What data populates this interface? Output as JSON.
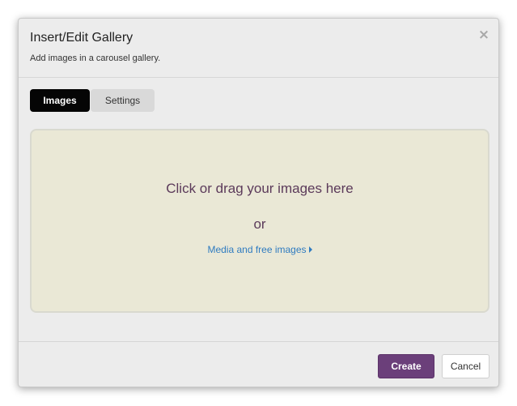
{
  "dialog": {
    "title": "Insert/Edit Gallery",
    "subtitle": "Add images in a carousel gallery.",
    "close_icon": "close-icon"
  },
  "tabs": [
    {
      "label": "Images",
      "active": true
    },
    {
      "label": "Settings",
      "active": false
    }
  ],
  "dropzone": {
    "main_text": "Click or drag your images here",
    "or_text": "or",
    "link_text": "Media and free images",
    "link_icon": "caret-right-icon"
  },
  "buttons": {
    "create_label": "Create",
    "cancel_label": "Cancel"
  },
  "colors": {
    "primary_button": "#6b3f7a",
    "dropzone_bg": "#eae8d6",
    "link": "#2f7bc0",
    "drop_text": "#5b3a5a"
  }
}
